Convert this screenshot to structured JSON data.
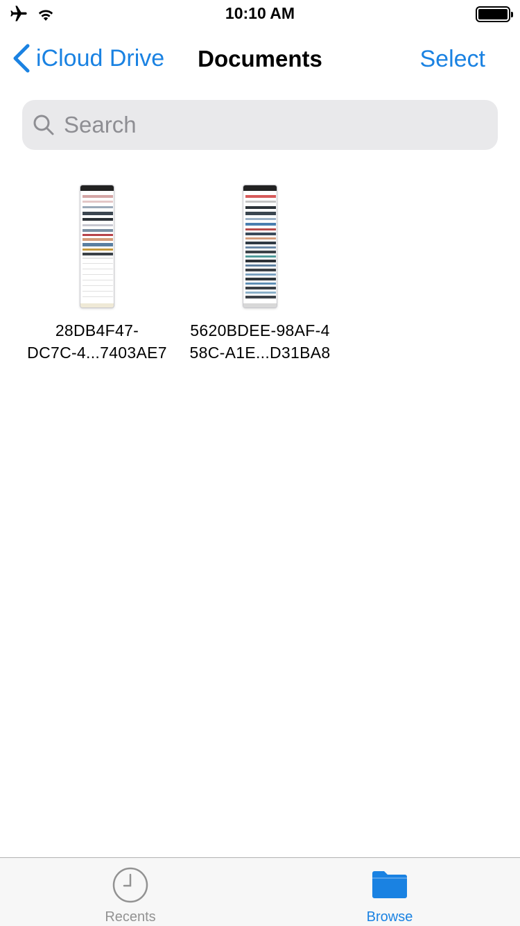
{
  "status_bar": {
    "time": "10:10 AM",
    "icons": [
      "airplane-icon",
      "wifi-icon",
      "battery-icon"
    ]
  },
  "nav": {
    "back_label": "iCloud Drive",
    "title": "Documents",
    "select_label": "Select"
  },
  "search": {
    "placeholder": "Search",
    "value": ""
  },
  "files": [
    {
      "name_line1": "28DB4F47-",
      "name_line2": "DC7C-4...7403AE7"
    },
    {
      "name_line1": "5620BDEE-98AF-4",
      "name_line2": "58C-A1E...D31BA8"
    }
  ],
  "tabs": [
    {
      "label": "Recents",
      "icon": "clock-icon",
      "selected": false
    },
    {
      "label": "Browse",
      "icon": "folder-icon",
      "selected": true
    }
  ],
  "colors": {
    "accent": "#1a82e2",
    "tab_inactive": "#929292",
    "search_bg": "#e9e9eb"
  }
}
